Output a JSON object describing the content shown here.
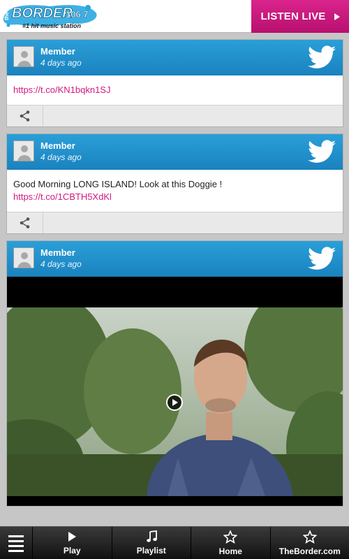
{
  "header": {
    "logo_small": "the",
    "logo_name": "BORDER",
    "logo_freq": "106.7",
    "logo_tagline": "#1 hit music station",
    "listen_live_label": "LISTEN LIVE"
  },
  "posts": [
    {
      "author": "Member",
      "time": "4 days ago",
      "text": "",
      "link": "https://t.co/KN1bqkn1SJ"
    },
    {
      "author": "Member",
      "time": "4 days ago",
      "text": "Good Morning LONG ISLAND! Look at this Doggie !",
      "link": "https://t.co/1CBTH5XdKl"
    },
    {
      "author": "Member",
      "time": "4 days ago",
      "has_video": true
    }
  ],
  "nav": {
    "items": [
      {
        "label": "Play",
        "icon": "play-icon"
      },
      {
        "label": "Playlist",
        "icon": "music-note-icon"
      },
      {
        "label": "Home",
        "icon": "star-icon"
      },
      {
        "label": "TheBorder.com",
        "icon": "star-icon"
      }
    ]
  },
  "colors": {
    "accent_pink": "#d3197f",
    "header_blue": "#1a82bf"
  }
}
